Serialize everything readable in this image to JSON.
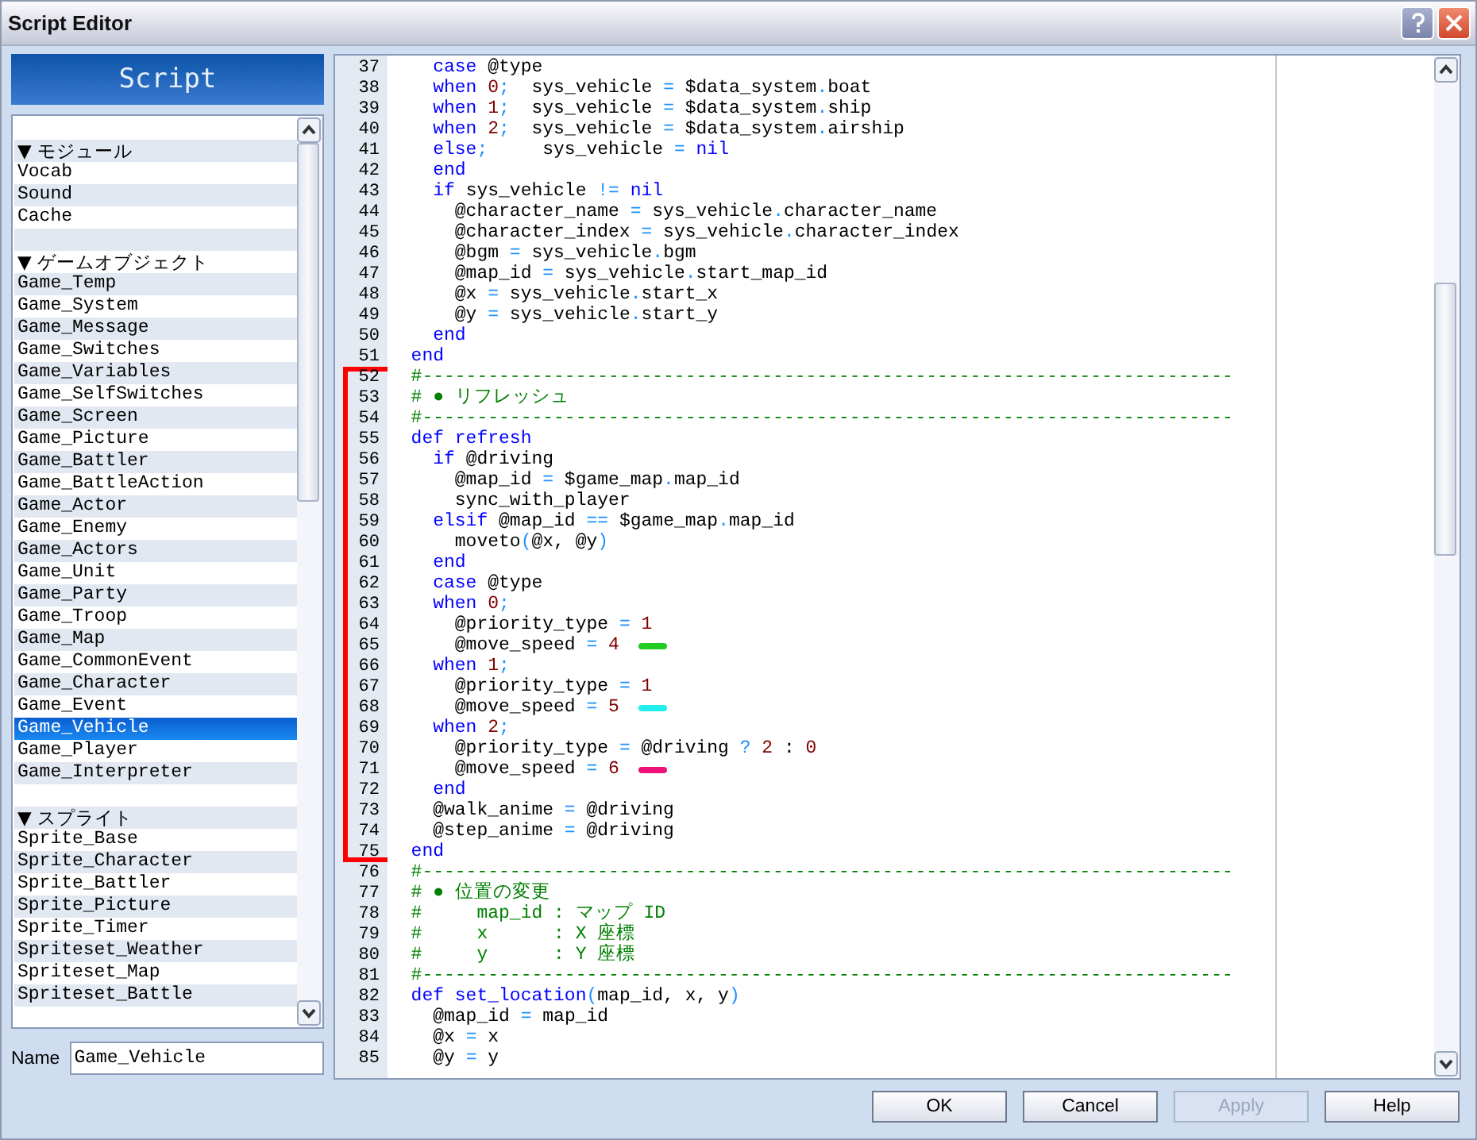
{
  "window": {
    "title": "Script Editor"
  },
  "sidebar": {
    "header": "Script",
    "items": [
      {
        "kind": "blank"
      },
      {
        "kind": "header",
        "label": "▼ モジュール",
        "selected": false
      },
      {
        "kind": "item",
        "label": "Vocab",
        "selected": false
      },
      {
        "kind": "item",
        "label": "Sound",
        "selected": false
      },
      {
        "kind": "item",
        "label": "Cache",
        "selected": false
      },
      {
        "kind": "blank"
      },
      {
        "kind": "header",
        "label": "▼ ゲームオブジェクト",
        "selected": false
      },
      {
        "kind": "item",
        "label": "Game_Temp",
        "selected": false
      },
      {
        "kind": "item",
        "label": "Game_System",
        "selected": false
      },
      {
        "kind": "item",
        "label": "Game_Message",
        "selected": false
      },
      {
        "kind": "item",
        "label": "Game_Switches",
        "selected": false
      },
      {
        "kind": "item",
        "label": "Game_Variables",
        "selected": false
      },
      {
        "kind": "item",
        "label": "Game_SelfSwitches",
        "selected": false
      },
      {
        "kind": "item",
        "label": "Game_Screen",
        "selected": false
      },
      {
        "kind": "item",
        "label": "Game_Picture",
        "selected": false
      },
      {
        "kind": "item",
        "label": "Game_Battler",
        "selected": false
      },
      {
        "kind": "item",
        "label": "Game_BattleAction",
        "selected": false
      },
      {
        "kind": "item",
        "label": "Game_Actor",
        "selected": false
      },
      {
        "kind": "item",
        "label": "Game_Enemy",
        "selected": false
      },
      {
        "kind": "item",
        "label": "Game_Actors",
        "selected": false
      },
      {
        "kind": "item",
        "label": "Game_Unit",
        "selected": false
      },
      {
        "kind": "item",
        "label": "Game_Party",
        "selected": false
      },
      {
        "kind": "item",
        "label": "Game_Troop",
        "selected": false
      },
      {
        "kind": "item",
        "label": "Game_Map",
        "selected": false
      },
      {
        "kind": "item",
        "label": "Game_CommonEvent",
        "selected": false
      },
      {
        "kind": "item",
        "label": "Game_Character",
        "selected": false
      },
      {
        "kind": "item",
        "label": "Game_Event",
        "selected": false
      },
      {
        "kind": "item",
        "label": "Game_Vehicle",
        "selected": true
      },
      {
        "kind": "item",
        "label": "Game_Player",
        "selected": false
      },
      {
        "kind": "item",
        "label": "Game_Interpreter",
        "selected": false
      },
      {
        "kind": "blank"
      },
      {
        "kind": "header",
        "label": "▼ スプライト",
        "selected": false
      },
      {
        "kind": "item",
        "label": "Sprite_Base",
        "selected": false
      },
      {
        "kind": "item",
        "label": "Sprite_Character",
        "selected": false
      },
      {
        "kind": "item",
        "label": "Sprite_Battler",
        "selected": false
      },
      {
        "kind": "item",
        "label": "Sprite_Picture",
        "selected": false
      },
      {
        "kind": "item",
        "label": "Sprite_Timer",
        "selected": false
      },
      {
        "kind": "item",
        "label": "Spriteset_Weather",
        "selected": false
      },
      {
        "kind": "item",
        "label": "Spriteset_Map",
        "selected": false
      },
      {
        "kind": "item",
        "label": "Spriteset_Battle",
        "selected": false
      }
    ],
    "name_label": "Name",
    "name_value": "Game_Vehicle"
  },
  "editor": {
    "lines": [
      {
        "n": "37",
        "tokens": [
          {
            "text": "    case",
            "kind": "keyword"
          },
          {
            "text": " @type",
            "kind": "plain"
          }
        ]
      },
      {
        "n": "38",
        "tokens": [
          {
            "text": "    when",
            "kind": "keyword"
          },
          {
            "text": " 0",
            "kind": "number"
          },
          {
            "text": ";",
            "kind": "operator"
          },
          {
            "text": "  sys_vehicle ",
            "kind": "plain"
          },
          {
            "text": "=",
            "kind": "operator"
          },
          {
            "text": " $data_system",
            "kind": "plain"
          },
          {
            "text": ".",
            "kind": "operator"
          },
          {
            "text": "boat",
            "kind": "plain"
          }
        ]
      },
      {
        "n": "39",
        "tokens": [
          {
            "text": "    when",
            "kind": "keyword"
          },
          {
            "text": " 1",
            "kind": "number"
          },
          {
            "text": ";",
            "kind": "operator"
          },
          {
            "text": "  sys_vehicle ",
            "kind": "plain"
          },
          {
            "text": "=",
            "kind": "operator"
          },
          {
            "text": " $data_system",
            "kind": "plain"
          },
          {
            "text": ".",
            "kind": "operator"
          },
          {
            "text": "ship",
            "kind": "plain"
          }
        ]
      },
      {
        "n": "40",
        "tokens": [
          {
            "text": "    when",
            "kind": "keyword"
          },
          {
            "text": " 2",
            "kind": "number"
          },
          {
            "text": ";",
            "kind": "operator"
          },
          {
            "text": "  sys_vehicle ",
            "kind": "plain"
          },
          {
            "text": "=",
            "kind": "operator"
          },
          {
            "text": " $data_system",
            "kind": "plain"
          },
          {
            "text": ".",
            "kind": "operator"
          },
          {
            "text": "airship",
            "kind": "plain"
          }
        ]
      },
      {
        "n": "41",
        "tokens": [
          {
            "text": "    else",
            "kind": "keyword"
          },
          {
            "text": ";",
            "kind": "operator"
          },
          {
            "text": "     sys_vehicle ",
            "kind": "plain"
          },
          {
            "text": "=",
            "kind": "operator"
          },
          {
            "text": " nil",
            "kind": "keyword"
          }
        ]
      },
      {
        "n": "42",
        "tokens": [
          {
            "text": "    end",
            "kind": "keyword"
          }
        ]
      },
      {
        "n": "43",
        "tokens": [
          {
            "text": "    if",
            "kind": "keyword"
          },
          {
            "text": " sys_vehicle ",
            "kind": "plain"
          },
          {
            "text": "!=",
            "kind": "operator"
          },
          {
            "text": " nil",
            "kind": "keyword"
          }
        ]
      },
      {
        "n": "44",
        "tokens": [
          {
            "text": "      @character_name ",
            "kind": "plain"
          },
          {
            "text": "=",
            "kind": "operator"
          },
          {
            "text": " sys_vehicle",
            "kind": "plain"
          },
          {
            "text": ".",
            "kind": "operator"
          },
          {
            "text": "character_name",
            "kind": "plain"
          }
        ]
      },
      {
        "n": "45",
        "tokens": [
          {
            "text": "      @character_index ",
            "kind": "plain"
          },
          {
            "text": "=",
            "kind": "operator"
          },
          {
            "text": " sys_vehicle",
            "kind": "plain"
          },
          {
            "text": ".",
            "kind": "operator"
          },
          {
            "text": "character_index",
            "kind": "plain"
          }
        ]
      },
      {
        "n": "46",
        "tokens": [
          {
            "text": "      @bgm ",
            "kind": "plain"
          },
          {
            "text": "=",
            "kind": "operator"
          },
          {
            "text": " sys_vehicle",
            "kind": "plain"
          },
          {
            "text": ".",
            "kind": "operator"
          },
          {
            "text": "bgm",
            "kind": "plain"
          }
        ]
      },
      {
        "n": "47",
        "tokens": [
          {
            "text": "      @map_id ",
            "kind": "plain"
          },
          {
            "text": "=",
            "kind": "operator"
          },
          {
            "text": " sys_vehicle",
            "kind": "plain"
          },
          {
            "text": ".",
            "kind": "operator"
          },
          {
            "text": "start_map_id",
            "kind": "plain"
          }
        ]
      },
      {
        "n": "48",
        "tokens": [
          {
            "text": "      @x ",
            "kind": "plain"
          },
          {
            "text": "=",
            "kind": "operator"
          },
          {
            "text": " sys_vehicle",
            "kind": "plain"
          },
          {
            "text": ".",
            "kind": "operator"
          },
          {
            "text": "start_x",
            "kind": "plain"
          }
        ]
      },
      {
        "n": "49",
        "tokens": [
          {
            "text": "      @y ",
            "kind": "plain"
          },
          {
            "text": "=",
            "kind": "operator"
          },
          {
            "text": " sys_vehicle",
            "kind": "plain"
          },
          {
            "text": ".",
            "kind": "operator"
          },
          {
            "text": "start_y",
            "kind": "plain"
          }
        ]
      },
      {
        "n": "50",
        "tokens": [
          {
            "text": "    end",
            "kind": "keyword"
          }
        ]
      },
      {
        "n": "51",
        "tokens": [
          {
            "text": "  end",
            "kind": "keyword"
          }
        ]
      },
      {
        "n": "52",
        "bracketed": true,
        "tokens": [
          {
            "text": "  #--------------------------------------------------------------------------",
            "kind": "comment"
          }
        ]
      },
      {
        "n": "53",
        "bracketed": true,
        "tokens": [
          {
            "text": "  # ● リフレッシュ",
            "kind": "comment"
          }
        ]
      },
      {
        "n": "54",
        "bracketed": true,
        "tokens": [
          {
            "text": "  #--------------------------------------------------------------------------",
            "kind": "comment"
          }
        ]
      },
      {
        "n": "55",
        "bracketed": true,
        "tokens": [
          {
            "text": "  def refresh",
            "kind": "keyword"
          }
        ]
      },
      {
        "n": "56",
        "bracketed": true,
        "tokens": [
          {
            "text": "    if",
            "kind": "keyword"
          },
          {
            "text": " @driving",
            "kind": "plain"
          }
        ]
      },
      {
        "n": "57",
        "bracketed": true,
        "tokens": [
          {
            "text": "      @map_id ",
            "kind": "plain"
          },
          {
            "text": "=",
            "kind": "operator"
          },
          {
            "text": " $game_map",
            "kind": "plain"
          },
          {
            "text": ".",
            "kind": "operator"
          },
          {
            "text": "map_id",
            "kind": "plain"
          }
        ]
      },
      {
        "n": "58",
        "bracketed": true,
        "tokens": [
          {
            "text": "      sync_with_player",
            "kind": "plain"
          }
        ]
      },
      {
        "n": "59",
        "bracketed": true,
        "tokens": [
          {
            "text": "    elsif",
            "kind": "keyword"
          },
          {
            "text": " @map_id ",
            "kind": "plain"
          },
          {
            "text": "==",
            "kind": "operator"
          },
          {
            "text": " $game_map",
            "kind": "plain"
          },
          {
            "text": ".",
            "kind": "operator"
          },
          {
            "text": "map_id",
            "kind": "plain"
          }
        ]
      },
      {
        "n": "60",
        "bracketed": true,
        "tokens": [
          {
            "text": "      moveto",
            "kind": "plain"
          },
          {
            "text": "(",
            "kind": "operator"
          },
          {
            "text": "@x, @y",
            "kind": "plain"
          },
          {
            "text": ")",
            "kind": "operator"
          }
        ]
      },
      {
        "n": "61",
        "bracketed": true,
        "tokens": [
          {
            "text": "    end",
            "kind": "keyword"
          }
        ]
      },
      {
        "n": "62",
        "bracketed": true,
        "tokens": [
          {
            "text": "    case",
            "kind": "keyword"
          },
          {
            "text": " @type",
            "kind": "plain"
          }
        ]
      },
      {
        "n": "63",
        "bracketed": true,
        "tokens": [
          {
            "text": "    when",
            "kind": "keyword"
          },
          {
            "text": " 0",
            "kind": "number"
          },
          {
            "text": ";",
            "kind": "operator"
          }
        ]
      },
      {
        "n": "64",
        "bracketed": true,
        "tokens": [
          {
            "text": "      @priority_type ",
            "kind": "plain"
          },
          {
            "text": "=",
            "kind": "operator"
          },
          {
            "text": " 1",
            "kind": "number"
          }
        ]
      },
      {
        "n": "65",
        "bracketed": true,
        "color": "#22cc22",
        "tokens": [
          {
            "text": "      @move_speed ",
            "kind": "plain"
          },
          {
            "text": "=",
            "kind": "operator"
          },
          {
            "text": " 4",
            "kind": "number"
          }
        ]
      },
      {
        "n": "66",
        "bracketed": true,
        "tokens": [
          {
            "text": "    when",
            "kind": "keyword"
          },
          {
            "text": " 1",
            "kind": "number"
          },
          {
            "text": ";",
            "kind": "operator"
          }
        ]
      },
      {
        "n": "67",
        "bracketed": true,
        "tokens": [
          {
            "text": "      @priority_type ",
            "kind": "plain"
          },
          {
            "text": "=",
            "kind": "operator"
          },
          {
            "text": " 1",
            "kind": "number"
          }
        ]
      },
      {
        "n": "68",
        "bracketed": true,
        "color": "#22eeee",
        "tokens": [
          {
            "text": "      @move_speed ",
            "kind": "plain"
          },
          {
            "text": "=",
            "kind": "operator"
          },
          {
            "text": " 5",
            "kind": "number"
          }
        ]
      },
      {
        "n": "69",
        "bracketed": true,
        "tokens": [
          {
            "text": "    when",
            "kind": "keyword"
          },
          {
            "text": " 2",
            "kind": "number"
          },
          {
            "text": ";",
            "kind": "operator"
          }
        ]
      },
      {
        "n": "70",
        "bracketed": true,
        "tokens": [
          {
            "text": "      @priority_type ",
            "kind": "plain"
          },
          {
            "text": "=",
            "kind": "operator"
          },
          {
            "text": " @driving ",
            "kind": "plain"
          },
          {
            "text": "?",
            "kind": "operator"
          },
          {
            "text": " 2",
            "kind": "number"
          },
          {
            "text": " : ",
            "kind": "plain"
          },
          {
            "text": "0",
            "kind": "number"
          }
        ]
      },
      {
        "n": "71",
        "bracketed": true,
        "color": "#ee1177",
        "tokens": [
          {
            "text": "      @move_speed ",
            "kind": "plain"
          },
          {
            "text": "=",
            "kind": "operator"
          },
          {
            "text": " 6",
            "kind": "number"
          }
        ]
      },
      {
        "n": "72",
        "bracketed": true,
        "tokens": [
          {
            "text": "    end",
            "kind": "keyword"
          }
        ]
      },
      {
        "n": "73",
        "bracketed": true,
        "tokens": [
          {
            "text": "    @walk_anime ",
            "kind": "plain"
          },
          {
            "text": "=",
            "kind": "operator"
          },
          {
            "text": " @driving",
            "kind": "plain"
          }
        ]
      },
      {
        "n": "74",
        "bracketed": true,
        "tokens": [
          {
            "text": "    @step_anime ",
            "kind": "plain"
          },
          {
            "text": "=",
            "kind": "operator"
          },
          {
            "text": " @driving",
            "kind": "plain"
          }
        ]
      },
      {
        "n": "75",
        "bracketed": true,
        "tokens": [
          {
            "text": "  end",
            "kind": "keyword"
          }
        ]
      },
      {
        "n": "76",
        "tokens": [
          {
            "text": "  #--------------------------------------------------------------------------",
            "kind": "comment"
          }
        ]
      },
      {
        "n": "77",
        "tokens": [
          {
            "text": "  # ● 位置の変更",
            "kind": "comment"
          }
        ]
      },
      {
        "n": "78",
        "tokens": [
          {
            "text": "  #     map_id : マップ ID",
            "kind": "comment"
          }
        ]
      },
      {
        "n": "79",
        "tokens": [
          {
            "text": "  #     x      : X 座標",
            "kind": "comment"
          }
        ]
      },
      {
        "n": "80",
        "tokens": [
          {
            "text": "  #     y      : Y 座標",
            "kind": "comment"
          }
        ]
      },
      {
        "n": "81",
        "tokens": [
          {
            "text": "  #--------------------------------------------------------------------------",
            "kind": "comment"
          }
        ]
      },
      {
        "n": "82",
        "tokens": [
          {
            "text": "  def set_location",
            "kind": "keyword"
          },
          {
            "text": "(",
            "kind": "operator"
          },
          {
            "text": "map_id, x, y",
            "kind": "plain"
          },
          {
            "text": ")",
            "kind": "operator"
          }
        ]
      },
      {
        "n": "83",
        "tokens": [
          {
            "text": "    @map_id ",
            "kind": "plain"
          },
          {
            "text": "=",
            "kind": "operator"
          },
          {
            "text": " map_id",
            "kind": "plain"
          }
        ]
      },
      {
        "n": "84",
        "tokens": [
          {
            "text": "    @x ",
            "kind": "plain"
          },
          {
            "text": "=",
            "kind": "operator"
          },
          {
            "text": " x",
            "kind": "plain"
          }
        ]
      },
      {
        "n": "85",
        "tokens": [
          {
            "text": "    @y ",
            "kind": "plain"
          },
          {
            "text": "=",
            "kind": "operator"
          },
          {
            "text": " y",
            "kind": "plain"
          }
        ]
      }
    ]
  },
  "buttons": [
    {
      "label": "OK",
      "disabled": false
    },
    {
      "label": "Cancel",
      "disabled": false
    },
    {
      "label": "Apply",
      "disabled": true
    },
    {
      "label": "Help",
      "disabled": false
    }
  ]
}
